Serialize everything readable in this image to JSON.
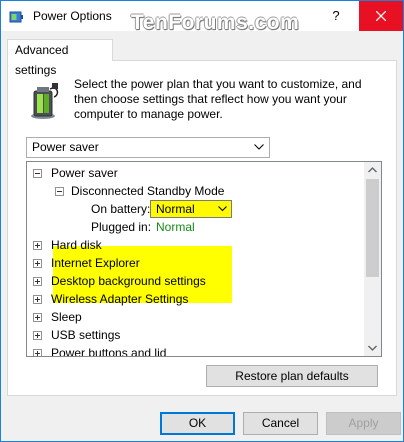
{
  "window": {
    "title": "Power Options",
    "help_glyph": "?",
    "watermark": "TenForums.com"
  },
  "tab": {
    "label": "Advanced settings"
  },
  "description": "Select the power plan that you want to customize, and then choose settings that reflect how you want your computer to manage power.",
  "plan_select": {
    "value": "Power saver"
  },
  "tree": {
    "root": "Power saver",
    "expanded_group": {
      "label": "Disconnected Standby Mode",
      "on_battery_label": "On battery:",
      "on_battery_value": "Normal",
      "plugged_in_label": "Plugged in:",
      "plugged_in_value": "Normal"
    },
    "items": [
      "Hard disk",
      "Internet Explorer",
      "Desktop background settings",
      "Wireless Adapter Settings",
      "Sleep",
      "USB settings",
      "Power buttons and lid"
    ]
  },
  "buttons": {
    "restore": "Restore plan defaults",
    "ok": "OK",
    "cancel": "Cancel",
    "apply": "Apply"
  },
  "colors": {
    "highlight": "#ffff00",
    "plugged_in_value": "#168a16",
    "close_button": "#e81123",
    "window_border": "#1883d7"
  }
}
